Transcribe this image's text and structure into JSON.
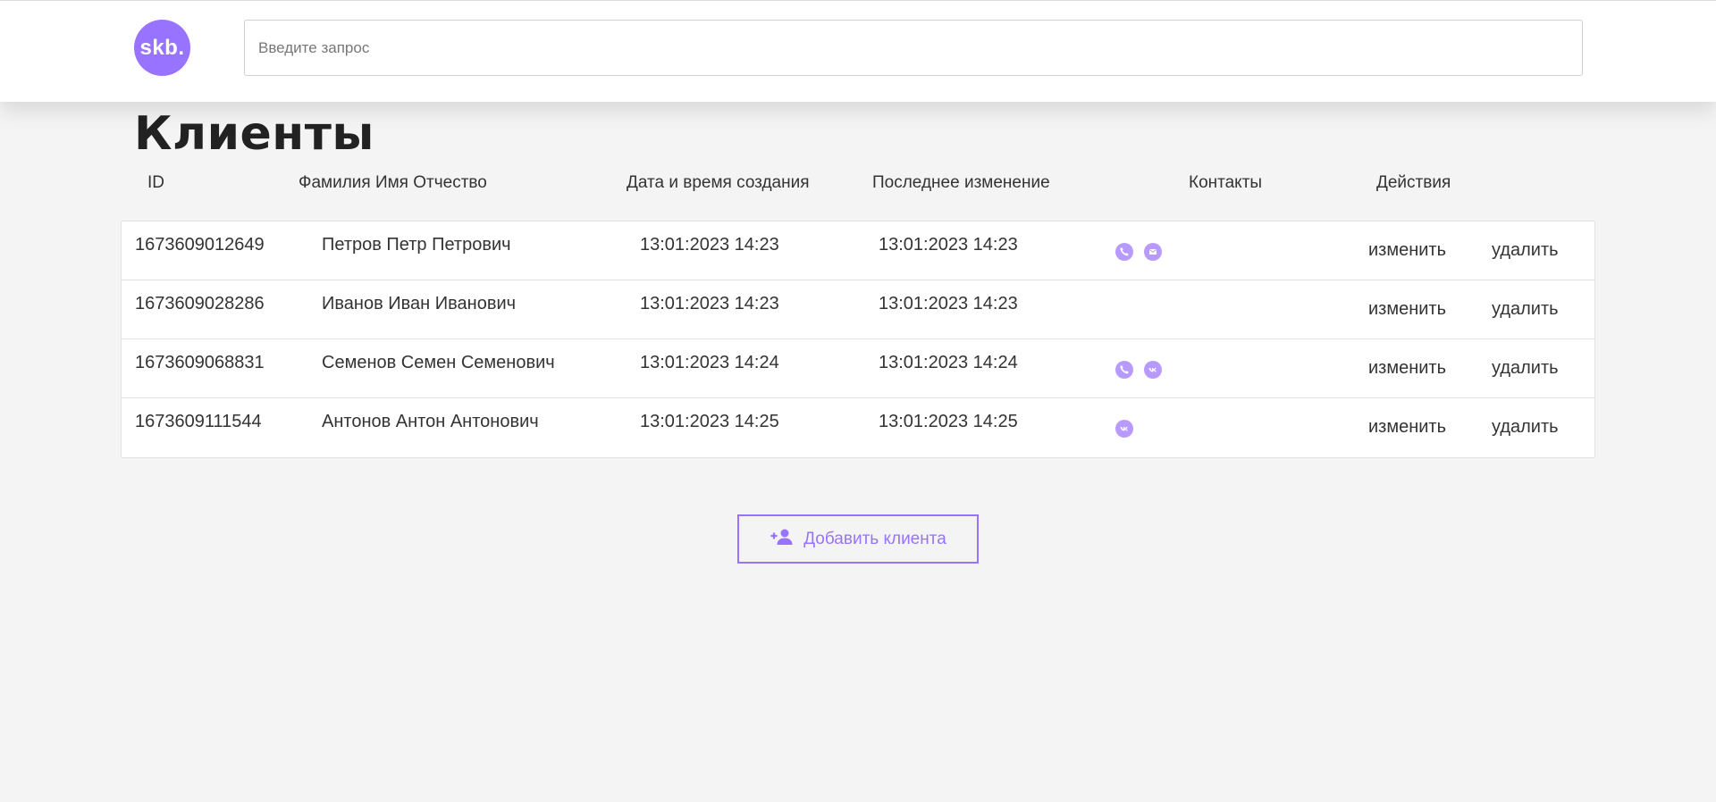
{
  "header": {
    "logo_text": "skb.",
    "search_placeholder": "Введите запрос",
    "search_value": ""
  },
  "page_title": "Клиенты",
  "columns": {
    "id": "ID",
    "fio": "Фамилия Имя Отчество",
    "created": "Дата и время создания",
    "changed": "Последнее изменение",
    "contacts": "Контакты",
    "actions": "Действия"
  },
  "clients": [
    {
      "id": "1673609012649",
      "fio": "Петров Петр Петрович",
      "created": "13:01:2023 14:23",
      "changed": "13:01:2023 14:23",
      "contacts": [
        "phone-icon",
        "mail-icon"
      ],
      "edit_label": "изменить",
      "delete_label": "удалить"
    },
    {
      "id": "1673609028286",
      "fio": "Иванов Иван Иванович",
      "created": "13:01:2023 14:23",
      "changed": "13:01:2023 14:23",
      "contacts": [],
      "edit_label": "изменить",
      "delete_label": "удалить"
    },
    {
      "id": "1673609068831",
      "fio": "Семенов Семен Семенович",
      "created": "13:01:2023 14:24",
      "changed": "13:01:2023 14:24",
      "contacts": [
        "phone-icon",
        "vk-icon"
      ],
      "edit_label": "изменить",
      "delete_label": "удалить"
    },
    {
      "id": "1673609111544",
      "fio": "Антонов Антон Антонович",
      "created": "13:01:2023 14:25",
      "changed": "13:01:2023 14:25",
      "contacts": [
        "vk-icon"
      ],
      "edit_label": "изменить",
      "delete_label": "удалить"
    }
  ],
  "add_button": {
    "label": "Добавить клиента",
    "icon": "add-user-icon"
  },
  "colors": {
    "accent": "#9873ff",
    "contact_icon": "#b89aff",
    "background": "#f4f4f4"
  }
}
